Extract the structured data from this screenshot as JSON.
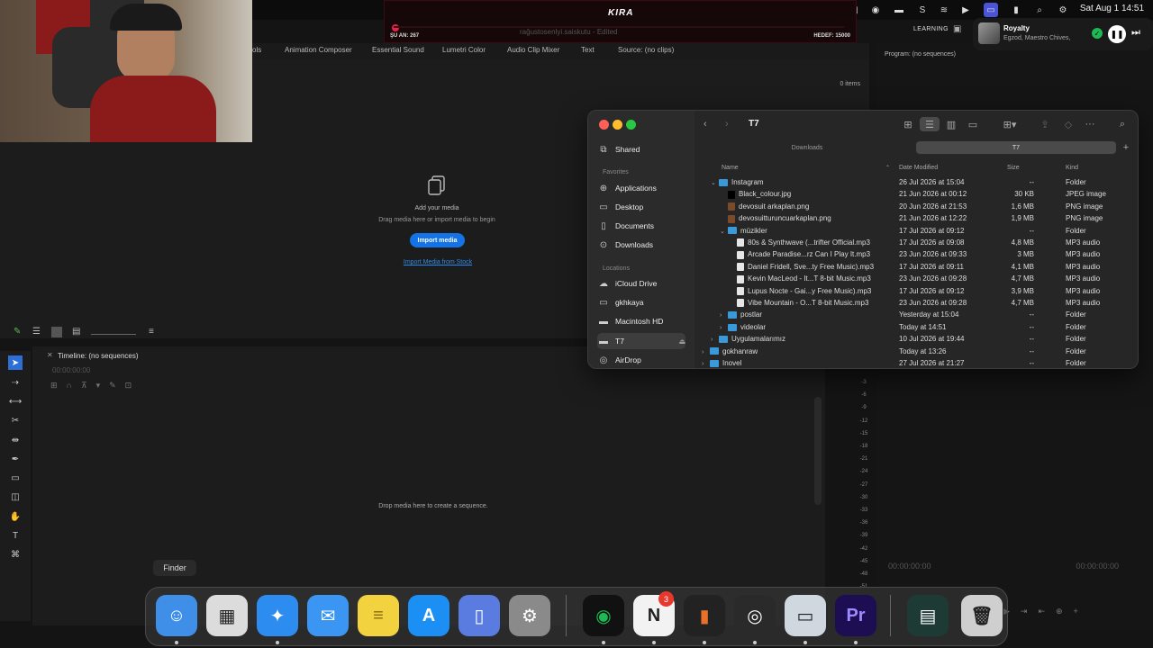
{
  "menubar": {
    "clock": "Sat Aug 1  14:51",
    "learning": "LEARNING"
  },
  "overlay": {
    "brand": "KIRA",
    "left_label": "ŞU AN: 267",
    "right_label": "HEDEF: 15000",
    "file_name": "rağustosenlyi.saiskutu - Edited"
  },
  "premiere": {
    "tabs": [
      "ols",
      "Animation Composer",
      "Essential Sound",
      "Lumetri Color",
      "Audio Clip Mixer",
      "Text",
      "Source: (no clips)"
    ],
    "items_count": "0 items",
    "add_title": "Add your media",
    "add_subtitle": "Drag media here or import media to begin",
    "import_button": "Import media",
    "import_stock": "Import Media from Stock",
    "timeline_title": "Timeline: (no sequences)",
    "timeline_timecode": "00:00:00:00",
    "timeline_drop": "Drop media here to create a sequence.",
    "program_title": "Program: (no sequences)",
    "program_tc_left": "00:00:00:00",
    "program_tc_right": "00:00:00:00",
    "meter_labels": [
      "-3",
      "-6",
      "-9",
      "-12",
      "-15",
      "-18",
      "-21",
      "-24",
      "-27",
      "-30",
      "-33",
      "-36",
      "-39",
      "-42",
      "-45",
      "-48",
      "-51"
    ]
  },
  "music": {
    "title": "Royalty",
    "artist": "Egzod, Maestro Chives,"
  },
  "finder": {
    "title": "T7",
    "path_tabs": [
      "Downloads",
      "T7"
    ],
    "sidebar": {
      "shared": "Shared",
      "favorites_header": "Favorites",
      "favorites": [
        "Applications",
        "Desktop",
        "Documents",
        "Downloads"
      ],
      "locations_header": "Locations",
      "locations": [
        "iCloud Drive",
        "gkhkaya",
        "Macintosh HD",
        "T7",
        "AirDrop"
      ]
    },
    "columns": {
      "name": "Name",
      "date": "Date Modified",
      "size": "Size",
      "kind": "Kind"
    },
    "rows": [
      {
        "name": "Instagram",
        "date": "26 Jul 2026 at 15:04",
        "size": "--",
        "kind": "Folder",
        "type": "folder",
        "level": 1,
        "disc": "v"
      },
      {
        "name": "Black_colour.jpg",
        "date": "21 Jun 2026 at 00:12",
        "size": "30 KB",
        "kind": "JPEG image",
        "type": "black",
        "level": 2,
        "disc": ""
      },
      {
        "name": "devosuit arkaplan.png",
        "date": "20 Jun 2026 at 21:53",
        "size": "1,6 MB",
        "kind": "PNG image",
        "type": "img",
        "level": 2,
        "disc": ""
      },
      {
        "name": "devosuitturuncuarkaplan.png",
        "date": "21 Jun 2026 at 12:22",
        "size": "1,9 MB",
        "kind": "PNG image",
        "type": "img",
        "level": 2,
        "disc": ""
      },
      {
        "name": "müzikler",
        "date": "17 Jul 2026 at 09:12",
        "size": "--",
        "kind": "Folder",
        "type": "folder",
        "level": 2,
        "disc": "v"
      },
      {
        "name": "80s & Synthwave (...trifter Official.mp3",
        "date": "17 Jul 2026 at 09:08",
        "size": "4,8 MB",
        "kind": "MP3 audio",
        "type": "file",
        "level": 3,
        "disc": ""
      },
      {
        "name": "Arcade Paradise...rz  Can I Play It.mp3",
        "date": "23 Jun 2026 at 09:33",
        "size": "3 MB",
        "kind": "MP3 audio",
        "type": "file",
        "level": 3,
        "disc": ""
      },
      {
        "name": "Daniel Fridell, Sve...ty Free Music).mp3",
        "date": "17 Jul 2026 at 09:11",
        "size": "4,1 MB",
        "kind": "MP3 audio",
        "type": "file",
        "level": 3,
        "disc": ""
      },
      {
        "name": "Kevin MacLeod - It...T 8-bit Music.mp3",
        "date": "23 Jun 2026 at 09:28",
        "size": "4,7 MB",
        "kind": "MP3 audio",
        "type": "file",
        "level": 3,
        "disc": ""
      },
      {
        "name": "Lupus Nocte - Gai...y Free Music).mp3",
        "date": "17 Jul 2026 at 09:12",
        "size": "3,9 MB",
        "kind": "MP3 audio",
        "type": "file",
        "level": 3,
        "disc": ""
      },
      {
        "name": "Vibe Mountain - O...T 8-bit Music.mp3",
        "date": "23 Jun 2026 at 09:28",
        "size": "4,7 MB",
        "kind": "MP3 audio",
        "type": "file",
        "level": 3,
        "disc": ""
      },
      {
        "name": "postlar",
        "date": "Yesterday at 15:04",
        "size": "--",
        "kind": "Folder",
        "type": "folder",
        "level": 2,
        "disc": ">"
      },
      {
        "name": "videolar",
        "date": "Today at 14:51",
        "size": "--",
        "kind": "Folder",
        "type": "folder",
        "level": 2,
        "disc": ">"
      },
      {
        "name": "Uygulamalarımız",
        "date": "10 Jul 2026 at 19:44",
        "size": "--",
        "kind": "Folder",
        "type": "folder",
        "level": 1,
        "disc": ">"
      },
      {
        "name": "gokhanraw",
        "date": "Today at 13:26",
        "size": "--",
        "kind": "Folder",
        "type": "folder",
        "level": 0,
        "disc": ">"
      },
      {
        "name": "Inovel",
        "date": "27 Jul 2026 at 21:27",
        "size": "--",
        "kind": "Folder",
        "type": "folder",
        "level": 0,
        "disc": ">"
      }
    ]
  },
  "dock": {
    "tooltip": "Finder",
    "notion_badge": "3",
    "apps": [
      {
        "name": "finder",
        "bg": "#3f8fe8",
        "glyph": "☺"
      },
      {
        "name": "launchpad",
        "bg": "#dcdcdc",
        "glyph": "▦"
      },
      {
        "name": "safari",
        "bg": "#2d8cf0",
        "glyph": "✦"
      },
      {
        "name": "mail",
        "bg": "#3a96f2",
        "glyph": "✉"
      },
      {
        "name": "notes",
        "bg": "#f3d23f",
        "glyph": "≡"
      },
      {
        "name": "app-store",
        "bg": "#1b8ff3",
        "glyph": "A"
      },
      {
        "name": "simulator",
        "bg": "#5a7be0",
        "glyph": "▯"
      },
      {
        "name": "system-settings",
        "bg": "#8a8a8a",
        "glyph": "⚙"
      },
      {
        "name": "spotify",
        "bg": "#111111",
        "glyph": "◉"
      },
      {
        "name": "notion",
        "bg": "#f2f2f2",
        "glyph": "N"
      },
      {
        "name": "audio-app",
        "bg": "#222222",
        "glyph": "▮"
      },
      {
        "name": "obs",
        "bg": "#2a2a2a",
        "glyph": "◎"
      },
      {
        "name": "screen-app",
        "bg": "#cfd7df",
        "glyph": "▭"
      },
      {
        "name": "premiere-pro",
        "bg": "#1d0d52",
        "glyph": "Pr"
      },
      {
        "name": "minimized-window",
        "bg": "#1d3a35",
        "glyph": "▤"
      },
      {
        "name": "trash",
        "bg": "#cfcfcf",
        "glyph": "🗑"
      }
    ]
  }
}
